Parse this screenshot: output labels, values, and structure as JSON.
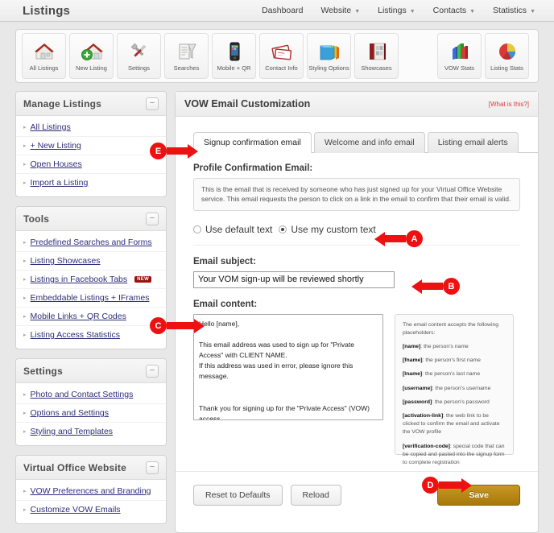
{
  "header": {
    "title": "Listings",
    "nav": [
      {
        "label": "Dashboard",
        "has_chevron": false
      },
      {
        "label": "Website",
        "has_chevron": true
      },
      {
        "label": "Listings",
        "has_chevron": true
      },
      {
        "label": "Contacts",
        "has_chevron": true
      },
      {
        "label": "Statistics",
        "has_chevron": true
      }
    ]
  },
  "toolbar": {
    "items": [
      {
        "label": "All Listings",
        "icon": "house-icon"
      },
      {
        "label": "New Listing",
        "icon": "house-plus-icon"
      },
      {
        "label": "Settings",
        "icon": "wrench-screwdriver-icon"
      },
      {
        "label": "Searches",
        "icon": "printer-icon"
      },
      {
        "label": "Mobile + QR",
        "icon": "smartphone-icon"
      },
      {
        "label": "Contact Info",
        "icon": "business-cards-icon"
      },
      {
        "label": "Styling Options",
        "icon": "folders-icon"
      },
      {
        "label": "Showcases",
        "icon": "book-icon"
      }
    ],
    "right_items": [
      {
        "label": "VOW Stats",
        "icon": "bar-chart-icon"
      },
      {
        "label": "Listing Stats",
        "icon": "pie-chart-icon"
      }
    ]
  },
  "sidebar": {
    "panels": [
      {
        "title": "Manage Listings",
        "collapse_glyph": "−",
        "items": [
          {
            "label": "All Listings",
            "badge": null
          },
          {
            "label": "+ New Listing",
            "badge": null
          },
          {
            "label": "Open Houses",
            "badge": null
          },
          {
            "label": "Import a Listing",
            "badge": null
          }
        ]
      },
      {
        "title": "Tools",
        "collapse_glyph": "−",
        "items": [
          {
            "label": "Predefined Searches and Forms",
            "badge": null
          },
          {
            "label": "Listing Showcases",
            "badge": null
          },
          {
            "label": "Listings in Facebook Tabs",
            "badge": "NEW"
          },
          {
            "label": "Embeddable Listings + IFrames",
            "badge": null
          },
          {
            "label": "Mobile Links + QR Codes",
            "badge": null
          },
          {
            "label": "Listing Access Statistics",
            "badge": null
          }
        ]
      },
      {
        "title": "Settings",
        "collapse_glyph": "−",
        "items": [
          {
            "label": "Photo and Contact Settings",
            "badge": null
          },
          {
            "label": "Options and Settings",
            "badge": null
          },
          {
            "label": "Styling and Templates",
            "badge": null
          }
        ]
      },
      {
        "title": "Virtual Office Website",
        "collapse_glyph": "−",
        "items": [
          {
            "label": "VOW Preferences and Branding",
            "badge": null
          },
          {
            "label": "Customize VOW Emails",
            "badge": null
          }
        ]
      }
    ]
  },
  "main": {
    "title": "VOW Email Customization",
    "what_is_this": "[What is this?]",
    "tabs": [
      {
        "label": "Signup confirmation email",
        "active": true
      },
      {
        "label": "Welcome and info email",
        "active": false
      },
      {
        "label": "Listing email alerts",
        "active": false
      }
    ],
    "section_label": "Profile Confirmation Email:",
    "info_text": "This is the email that is received by someone who has just signed up for your Virtual Office Website service. This email requests the person to click on a link in the email to confirm that their email is valid.",
    "radio_options": [
      {
        "label": "Use default text",
        "selected": false
      },
      {
        "label": "Use my custom text",
        "selected": true
      }
    ],
    "subject_label": "Email subject:",
    "subject_value": "Your VOM sign-up will be reviewed shortly",
    "content_label": "Email content:",
    "content_value": "Hello [name],\n\nThis email address was used to sign up for \"Private Access\" with CLIENT NAME.\nIf this address was used in error, please ignore this message.\n\n\nThank you for signing up for the \"Private Access\" (VOW) access.\n\nYour signup will be reviewed and activated shortly.\n",
    "placeholders": {
      "intro": "The email content accepts the following placeholders:",
      "entries": [
        {
          "token": "[name]",
          "desc": ": the person's name"
        },
        {
          "token": "[fname]",
          "desc": ": the person's first name"
        },
        {
          "token": "[lname]",
          "desc": ": the person's last name"
        },
        {
          "token": "[username]",
          "desc": ": the person's username"
        },
        {
          "token": "[password]",
          "desc": ": the person's password"
        },
        {
          "token": "[activation-link]",
          "desc": ": the web link to be clicked to confirm the email and activate the VOW profile"
        },
        {
          "token": "[verification-code]",
          "desc": ": special code that can be copied and pasted into the signup form to complete registration"
        }
      ]
    },
    "buttons": {
      "reset": "Reset to Defaults",
      "reload": "Reload",
      "save": "Save"
    }
  },
  "annotations": [
    {
      "letter": "A",
      "target": "use-my-custom-text-radio"
    },
    {
      "letter": "B",
      "target": "email-subject-input"
    },
    {
      "letter": "C",
      "target": "email-content-textarea"
    },
    {
      "letter": "D",
      "target": "save-button"
    },
    {
      "letter": "E",
      "target": "signup-confirmation-email-tab"
    }
  ],
  "colors": {
    "annotation_red": "#ee1111",
    "save_gold": "#b4840f",
    "link_blue": "#2d2d7a",
    "badge_red": "#9c1010"
  }
}
